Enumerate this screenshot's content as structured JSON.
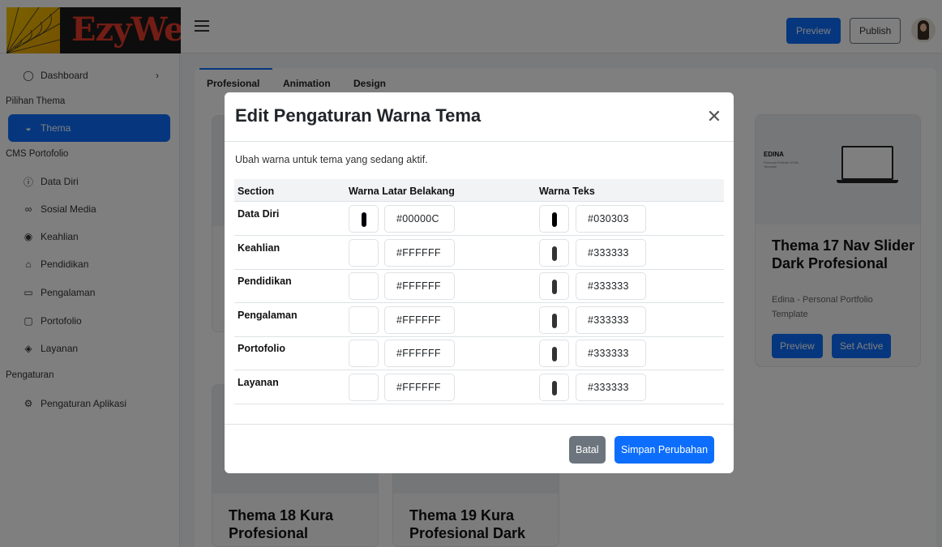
{
  "app": {
    "brand": "EzyWeb",
    "preview_label": "Preview",
    "publish_label": "Publish"
  },
  "sidebar": {
    "dashboard": "Dashboard",
    "section_thema": "Pilihan Thema",
    "thema": "Thema",
    "section_cms": "CMS Portofolio",
    "items": [
      {
        "label": "Data Diri",
        "icon": "info-icon"
      },
      {
        "label": "Sosial Media",
        "icon": "link-icon"
      },
      {
        "label": "Keahlian",
        "icon": "target-icon"
      },
      {
        "label": "Pendidikan",
        "icon": "graduation-icon"
      },
      {
        "label": "Pengalaman",
        "icon": "briefcase-icon"
      },
      {
        "label": "Portofolio",
        "icon": "folder-icon"
      },
      {
        "label": "Layanan",
        "icon": "layers-icon"
      }
    ],
    "section_settings": "Pengaturan",
    "app_settings": "Pengaturan Aplikasi"
  },
  "tabs": [
    "Profesional",
    "Animation",
    "Design"
  ],
  "cards": [
    {
      "title": "Thema 17 Nav Slider Dark Profesional",
      "subtitle": "Edina - Personal Portfolio Template",
      "preview": "Preview",
      "set_active": "Set Active",
      "thumb_title": "EDINA",
      "thumb_sub": "Personal Portfolio HTML Template"
    },
    {
      "title": "Thema 18 Kura Profesional"
    },
    {
      "title": "Thema 19 Kura Profesional Dark"
    }
  ],
  "modal": {
    "title": "Edit Pengaturan Warna Tema",
    "description": "Ubah warna untuk tema yang sedang aktif.",
    "col_section": "Section",
    "col_bg": "Warna Latar Belakang",
    "col_text": "Warna Teks",
    "rows": [
      {
        "section": "Data Diri",
        "bg": "#00000C",
        "bg_color": "#00000c",
        "text": "#030303",
        "text_color": "#030303"
      },
      {
        "section": "Keahlian",
        "bg": "#FFFFFF",
        "bg_color": "#ffffff",
        "text": "#333333",
        "text_color": "#333333"
      },
      {
        "section": "Pendidikan",
        "bg": "#FFFFFF",
        "bg_color": "#ffffff",
        "text": "#333333",
        "text_color": "#333333"
      },
      {
        "section": "Pengalaman",
        "bg": "#FFFFFF",
        "bg_color": "#ffffff",
        "text": "#333333",
        "text_color": "#333333"
      },
      {
        "section": "Portofolio",
        "bg": "#FFFFFF",
        "bg_color": "#ffffff",
        "text": "#333333",
        "text_color": "#333333"
      },
      {
        "section": "Layanan",
        "bg": "#FFFFFF",
        "bg_color": "#ffffff",
        "text": "#333333",
        "text_color": "#333333"
      }
    ],
    "cancel_label": "Batal",
    "save_label": "Simpan Perubahan"
  },
  "colors": {
    "primary": "#0d6efd",
    "secondary": "#6c757d"
  }
}
